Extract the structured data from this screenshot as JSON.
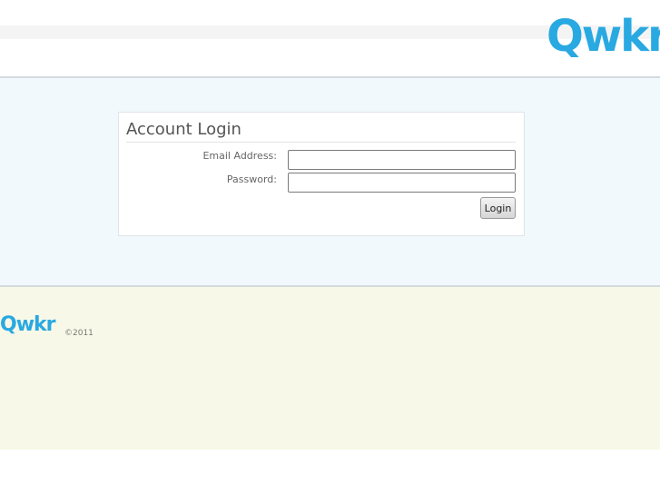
{
  "header": {
    "logo_text": "Qwkr"
  },
  "login": {
    "title": "Account Login",
    "email_label": "Email Address:",
    "email_value": "",
    "password_label": "Password:",
    "password_value": "",
    "submit_label": "Login"
  },
  "footer": {
    "logo_text": "Qwkr",
    "copyright": "©2011"
  },
  "colors": {
    "brand": "#29a9e1",
    "main_bg": "#f2f9fc",
    "footer_bg": "#f8f8e8"
  }
}
